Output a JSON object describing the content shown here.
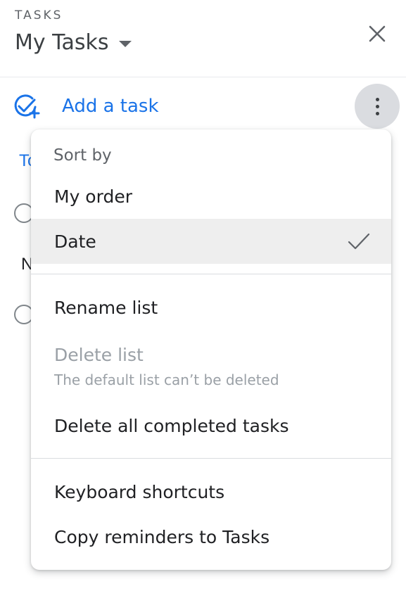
{
  "header": {
    "app_label": "TASKS",
    "list_title": "My Tasks",
    "close_icon": "close-icon",
    "dropdown_icon": "caret-down-icon"
  },
  "toolbar": {
    "add_task_label": "Add a task",
    "add_task_icon": "check-circle-plus-icon",
    "more_icon": "more-vert-icon"
  },
  "background": {
    "section_fragment": "To",
    "row_fragment": "N"
  },
  "menu": {
    "sort_header": "Sort by",
    "sort_options": [
      {
        "label": "My order",
        "selected": false
      },
      {
        "label": "Date",
        "selected": true
      }
    ],
    "rename_label": "Rename list",
    "delete_label": "Delete list",
    "delete_sublabel": "The default list can’t be deleted",
    "delete_completed_label": "Delete all completed tasks",
    "keyboard_shortcuts_label": "Keyboard shortcuts",
    "copy_reminders_label": "Copy reminders to Tasks"
  },
  "colors": {
    "accent": "#1a73e8",
    "text_primary": "#202124",
    "text_secondary": "#5f6368",
    "text_disabled": "#9aa0a6",
    "selected_bg": "#eeeeee"
  }
}
